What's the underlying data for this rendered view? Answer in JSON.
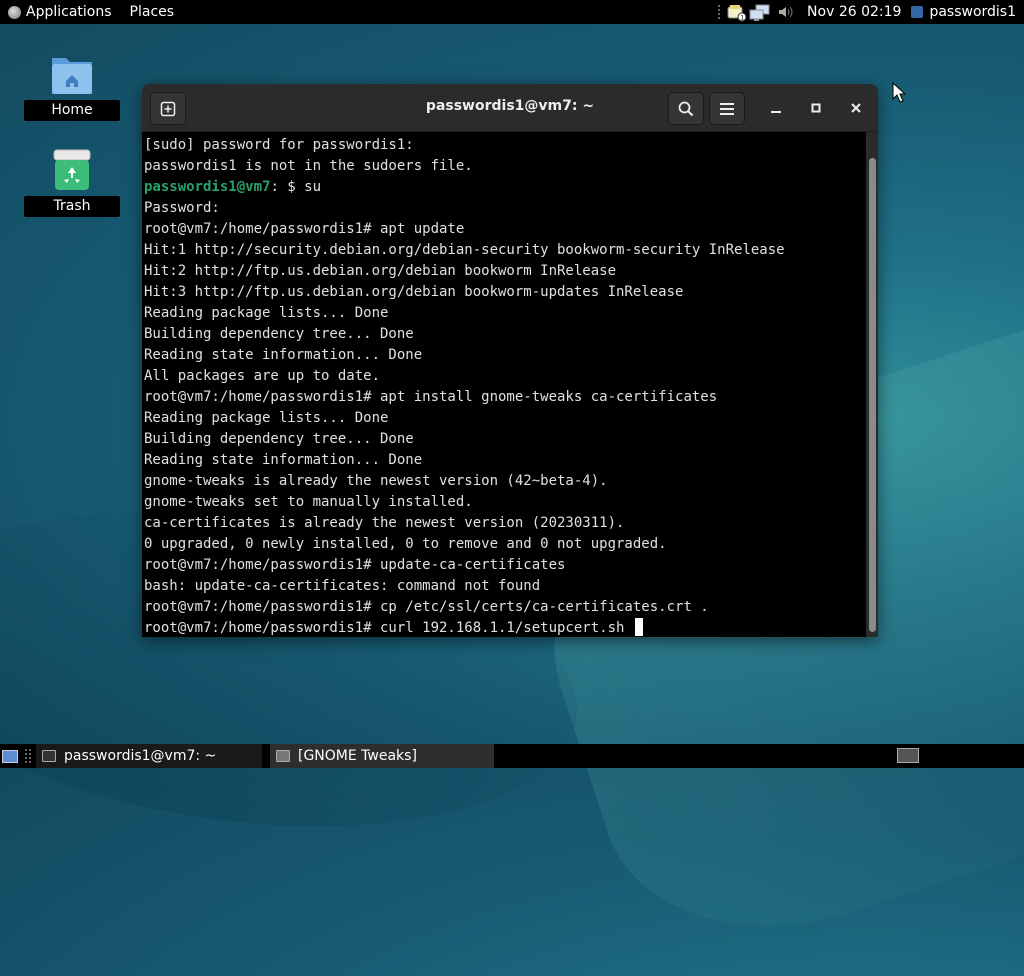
{
  "top_panel": {
    "applications_label": "Applications",
    "places_label": "Places",
    "clock": "Nov 26  02:19",
    "user": "passwordis1"
  },
  "desktop": {
    "icons": [
      {
        "label": "Home",
        "icon": "home-folder-icon"
      },
      {
        "label": "Trash",
        "icon": "trash-icon"
      }
    ]
  },
  "terminal": {
    "title": "passwordis1@vm7: ~",
    "lines": [
      {
        "text": "[sudo] password for passwordis1:"
      },
      {
        "text": "passwordis1 is not in the sudoers file."
      },
      {
        "prompt_user": "passwordis1@vm7",
        "text": ": $ su"
      },
      {
        "text": "Password:"
      },
      {
        "text": "root@vm7:/home/passwordis1# apt update"
      },
      {
        "text": "Hit:1 http://security.debian.org/debian-security bookworm-security InRelease"
      },
      {
        "text": "Hit:2 http://ftp.us.debian.org/debian bookworm InRelease"
      },
      {
        "text": "Hit:3 http://ftp.us.debian.org/debian bookworm-updates InRelease"
      },
      {
        "text": "Reading package lists... Done"
      },
      {
        "text": "Building dependency tree... Done"
      },
      {
        "text": "Reading state information... Done"
      },
      {
        "text": "All packages are up to date."
      },
      {
        "text": "root@vm7:/home/passwordis1# apt install gnome-tweaks ca-certificates"
      },
      {
        "text": "Reading package lists... Done"
      },
      {
        "text": "Building dependency tree... Done"
      },
      {
        "text": "Reading state information... Done"
      },
      {
        "text": "gnome-tweaks is already the newest version (42~beta-4)."
      },
      {
        "text": "gnome-tweaks set to manually installed."
      },
      {
        "text": "ca-certificates is already the newest version (20230311)."
      },
      {
        "text": "0 upgraded, 0 newly installed, 0 to remove and 0 not upgraded."
      },
      {
        "text": "root@vm7:/home/passwordis1# update-ca-certificates"
      },
      {
        "text": "bash: update-ca-certificates: command not found"
      },
      {
        "text": "root@vm7:/home/passwordis1# cp /etc/ssl/certs/ca-certificates.crt ."
      },
      {
        "text": "root@vm7:/home/passwordis1# curl 192.168.1.1/setupcert.sh ",
        "cursor": true
      }
    ]
  },
  "taskbar": {
    "tasks": [
      {
        "label": "passwordis1@vm7: ~",
        "icon": "terminal-icon",
        "active": true
      },
      {
        "label": "[GNOME Tweaks]",
        "icon": "tweaks-icon",
        "active": false
      }
    ]
  },
  "colors": {
    "prompt_user": "#26a269",
    "terminal_bg": "#000000",
    "headerbar_bg": "#2b2b2b",
    "accent": "#3465a4"
  }
}
